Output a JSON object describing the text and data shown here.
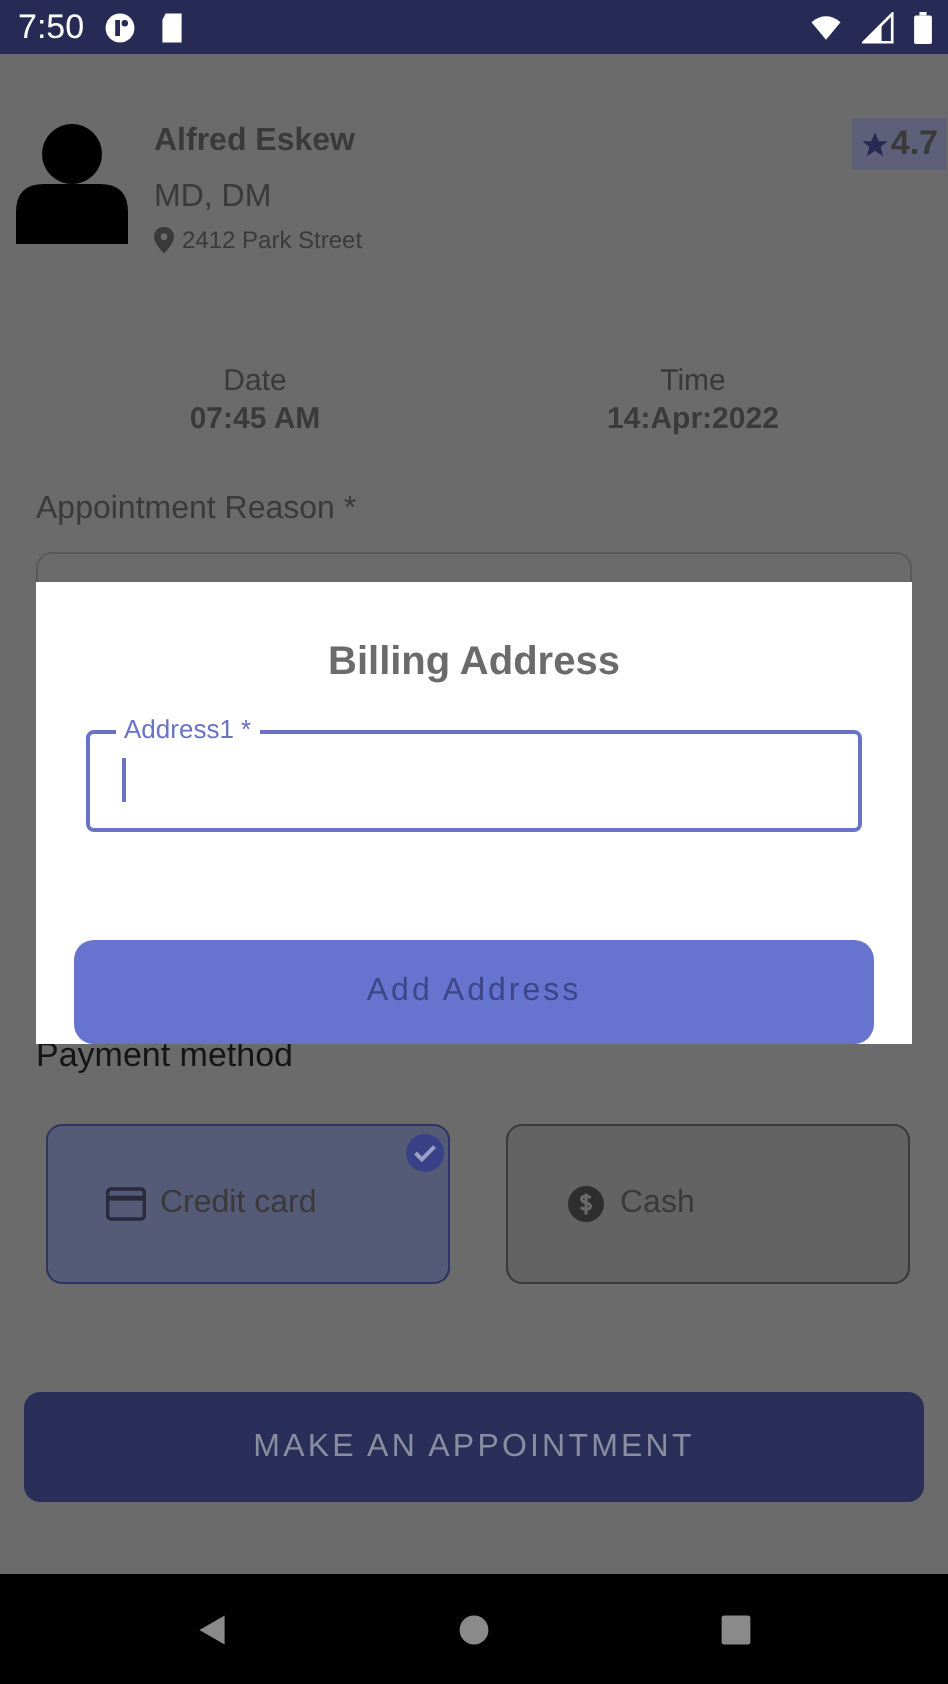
{
  "status_bar": {
    "time": "7:50"
  },
  "doctor": {
    "name": "Alfred Eskew",
    "degree": "MD, DM",
    "address": "2412 Park Street",
    "rating": "4.7"
  },
  "schedule": [
    {
      "label": "Date",
      "value": "07:45 AM"
    },
    {
      "label": "Time",
      "value": "14:Apr:2022"
    }
  ],
  "reason": {
    "label": "Appointment Reason *"
  },
  "payment": {
    "label": "Payment method",
    "options": [
      {
        "label": "Credit card",
        "kind": "card",
        "selected": true
      },
      {
        "label": "Cash",
        "kind": "cash",
        "selected": false
      }
    ]
  },
  "submit": {
    "label": "MAKE AN APPOINTMENT"
  },
  "dialog": {
    "title": "Billing Address",
    "field": {
      "label": "Address1 *"
    },
    "button": "Add Address"
  }
}
